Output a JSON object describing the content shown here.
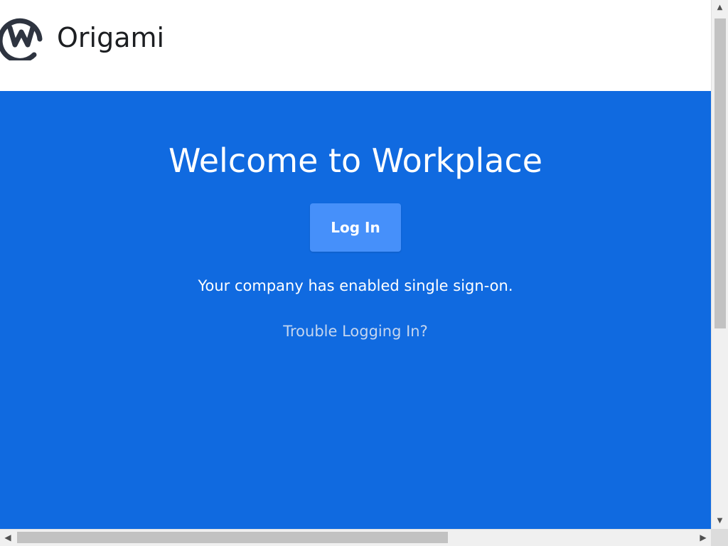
{
  "header": {
    "logo_icon": "workplace-logo-icon",
    "brand_name": "Origami"
  },
  "hero": {
    "background_color": "#106ae0",
    "title": "Welcome to Workplace",
    "login_button_label": "Log In",
    "login_button_color": "#4690fa",
    "sso_message": "Your company has enabled single sign-on.",
    "trouble_link": "Trouble Logging In?"
  },
  "scrollbars": {
    "vertical": {
      "up_icon": "arrow-up-icon",
      "down_icon": "arrow-down-icon"
    },
    "horizontal": {
      "left_icon": "arrow-left-icon",
      "right_icon": "arrow-right-icon"
    }
  }
}
